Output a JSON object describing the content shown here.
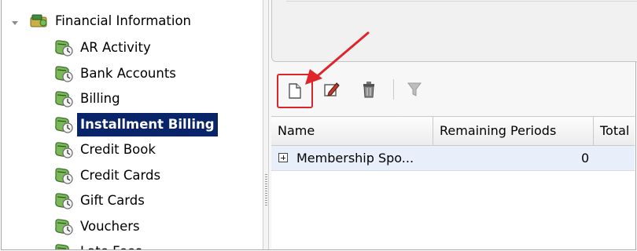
{
  "tree": {
    "root_label": "Financial Information",
    "items": [
      {
        "label": "AR Activity",
        "selected": false
      },
      {
        "label": "Bank Accounts",
        "selected": false
      },
      {
        "label": "Billing",
        "selected": false
      },
      {
        "label": "Installment Billing",
        "selected": true
      },
      {
        "label": "Credit Book",
        "selected": false
      },
      {
        "label": "Credit Cards",
        "selected": false
      },
      {
        "label": "Gift Cards",
        "selected": false
      },
      {
        "label": "Vouchers",
        "selected": false
      },
      {
        "label": "Late Fees",
        "selected": false
      }
    ]
  },
  "toolbar": {
    "buttons": [
      {
        "icon": "new-document-icon"
      },
      {
        "icon": "edit-icon"
      },
      {
        "icon": "delete-icon"
      },
      {
        "icon": "filter-icon"
      }
    ]
  },
  "grid": {
    "columns": [
      "Name",
      "Remaining Periods",
      "Total"
    ],
    "rows": [
      {
        "name": "Membership Spo...",
        "remaining_periods": "0",
        "total": ""
      }
    ]
  },
  "colors": {
    "selection": "#0a246a",
    "highlight_box": "#d8262a",
    "arrow": "#e0242a",
    "row_background": "#e9effa"
  }
}
